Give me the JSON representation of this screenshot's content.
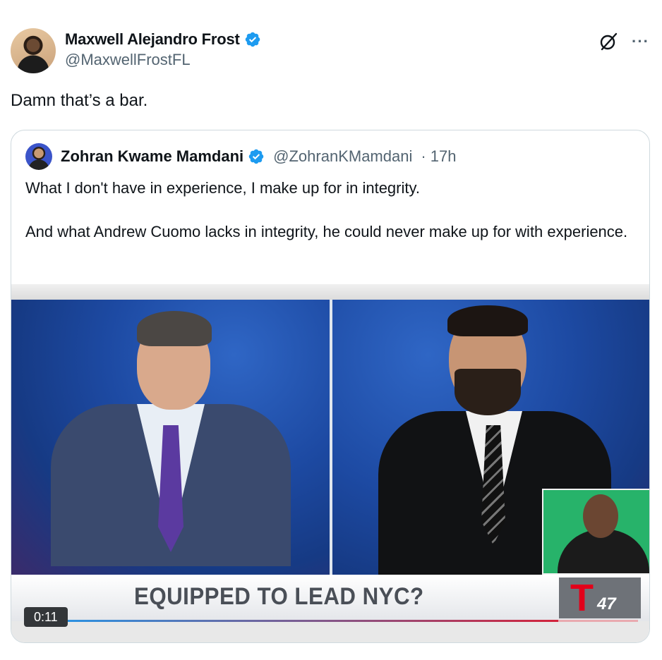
{
  "author": {
    "name": "Maxwell Alejandro Frost",
    "handle": "@MaxwellFrostFL",
    "verified_color": "#1d9bf0"
  },
  "tweet_text": "Damn that’s a bar.",
  "icons": [
    "grok-icon",
    "more-icon"
  ],
  "more_label": "···",
  "quoted": {
    "name": "Zohran Kwame Mamdani",
    "handle": "@ZohranKMamdani",
    "time": "· 17h",
    "lines": [
      "What I don't have in experience, I make up for in integrity.",
      "And what Andrew Cuomo lacks in integrity, he could never make up for with experience."
    ]
  },
  "video": {
    "banner": "EQUIPPED TO LEAD NYC?",
    "channel_number": "47",
    "timestamp": "0:11",
    "progress": 0.87,
    "progress_color": "#d3233b"
  }
}
